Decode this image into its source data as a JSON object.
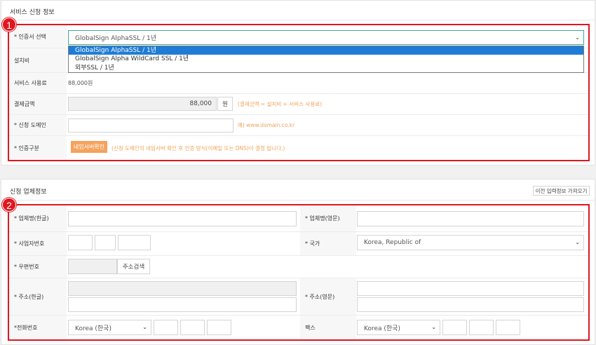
{
  "section1": {
    "title": "서비스 신청 정보",
    "badge": "1",
    "cert_label": "* 인증서 선택",
    "cert_value": "GlobalSign AlphaSSL / 1년",
    "cert_options": [
      "GlobalSign AlphaSSL / 1년",
      "GlobalSign Alpha WildCard SSL / 1년",
      "외부SSL / 1년"
    ],
    "setup_label": "설치비",
    "fee_label": "서비스 사용료",
    "fee_value": "88,000원",
    "pay_label": "결제금액",
    "pay_value": "88,000",
    "pay_unit": "원",
    "pay_hint": "(결제금액 = 설치비 + 서비스 사용료)",
    "domain_label": "* 신청 도메인",
    "domain_hint": "예) www.domain.co.kr",
    "auth_label": "* 인증구분",
    "auth_button": "네임서버확인",
    "auth_hint": "(신청 도메인의 네임서버 확인 후 인증 방식(이메일 또는 DNS)이 결정 됩니다.)"
  },
  "section2": {
    "title": "신청 업체정보",
    "badge": "2",
    "prev_button": "이전 입력정보 가져오기",
    "company_kr_label": "* 업체명(한글)",
    "company_en_label": "* 업체명(영문)",
    "bizno_label": "* 사업자번호",
    "country_label": "* 국가",
    "country_value": "Korea, Republic of",
    "zip_label": "* 우편번호",
    "zip_button": "주소검색",
    "addr_kr_label": "* 주소(한글)",
    "addr_en_label": "* 주소(영문)",
    "phone_label": "*전화번호",
    "phone_country": "Korea (한국)",
    "fax_label": "팩스",
    "fax_country": "Korea (한국)"
  },
  "colors": {
    "accent_red": "#e0161f",
    "hint_orange": "#f0a35a",
    "button_orange": "#f5a25d",
    "selected_blue": "#1f7cd6"
  }
}
